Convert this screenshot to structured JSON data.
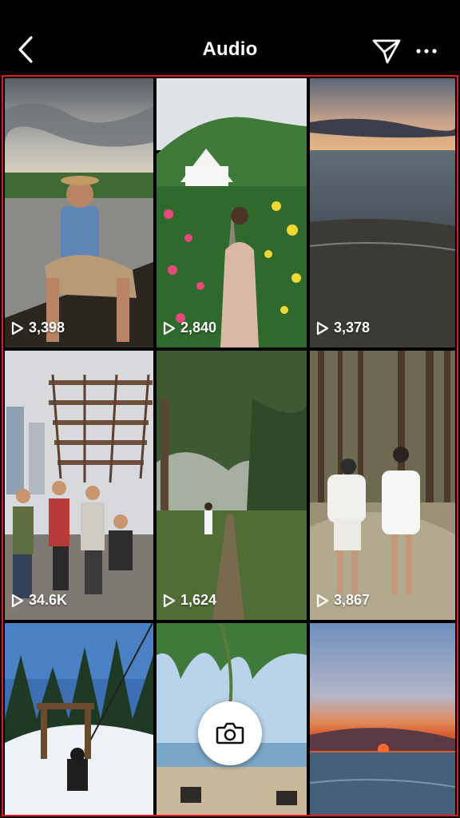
{
  "header": {
    "title": "Audio"
  },
  "grid": {
    "tiles": [
      {
        "views": "3,398"
      },
      {
        "views": "2,840"
      },
      {
        "views": "3,378"
      },
      {
        "views": "34.6K"
      },
      {
        "views": "1,624"
      },
      {
        "views": "3,867"
      },
      {
        "views": ""
      },
      {
        "views": ""
      },
      {
        "views": ""
      }
    ]
  },
  "colors": {
    "background": "#000000",
    "highlight_border": "#e11a1a",
    "text": "#ffffff"
  },
  "icons": {
    "back": "chevron-left-icon",
    "send": "paper-plane-icon",
    "more": "ellipsis-icon",
    "play": "play-outline-icon",
    "camera": "camera-icon"
  }
}
